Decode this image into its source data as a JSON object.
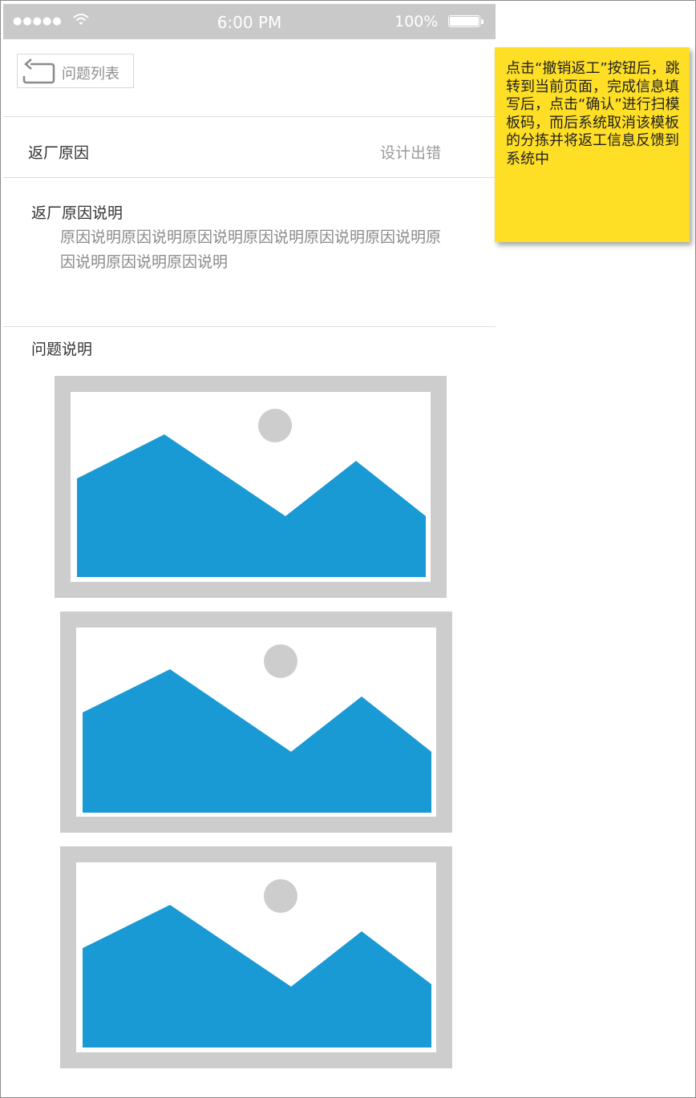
{
  "status_bar": {
    "signal": "●●●●●",
    "wifi_icon": "wifi-icon",
    "time": "6:00 PM",
    "battery": "100%"
  },
  "nav": {
    "back_label": "问题列表",
    "back_icon": "return-arrow-icon"
  },
  "form": {
    "return_reason_label": "返厂原因",
    "return_reason_value": "设计出错",
    "reason_desc_label": "返厂原因说明",
    "reason_desc_text": "原因说明原因说明原因说明原因说明原因说明原因说明原因说明原因说明原因说明",
    "problem_desc_label": "问题说明"
  },
  "images": [
    {
      "name": "image-placeholder-1"
    },
    {
      "name": "image-placeholder-2"
    },
    {
      "name": "image-placeholder-3"
    }
  ],
  "annotation": {
    "text": "点击“撤销返工”按钮后，跳转到当前页面，完成信息填写后，点击“确认”进行扫模板码，而后系统取消该模板的分拣并将返工信息反馈到系统中"
  },
  "colors": {
    "status_bar": "#c9c9c9",
    "placeholder_frame": "#cdcdcd",
    "mountain": "#1a9ad5",
    "sun": "#cdcdcd",
    "note": "#ffdf25"
  }
}
